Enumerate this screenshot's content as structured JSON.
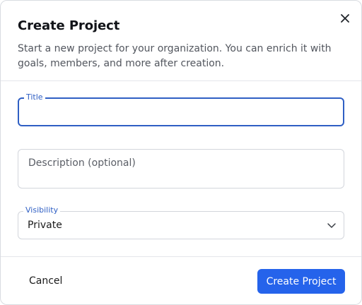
{
  "dialog": {
    "title": "Create Project",
    "subtitle": "Start a new project for your organization. You can enrich it with goals, members, and more after creation.",
    "close_icon": "close-icon"
  },
  "form": {
    "title_field": {
      "label": "Title",
      "value": ""
    },
    "description_field": {
      "placeholder": "Description (optional)",
      "value": ""
    },
    "visibility_field": {
      "label": "Visibility",
      "selected": "Private",
      "icon": "chevron-down-icon"
    }
  },
  "footer": {
    "cancel_label": "Cancel",
    "create_label": "Create Project"
  },
  "colors": {
    "primary": "#2563eb",
    "focus_border": "#2f5fc4",
    "border": "#d3d6dc",
    "subtitle_text": "#52565e"
  }
}
